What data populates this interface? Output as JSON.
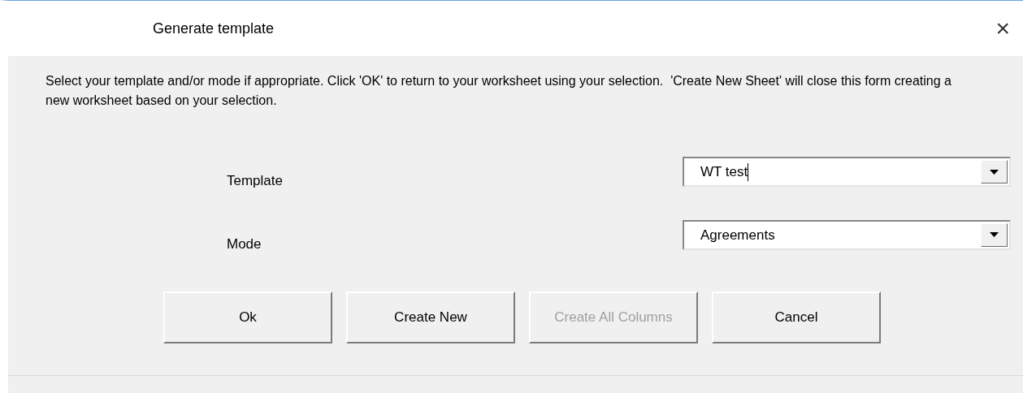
{
  "window": {
    "title": "Generate template",
    "close": "×"
  },
  "instructions": "Select your template and/or mode if appropriate. Click 'OK' to return to your worksheet using your selection.  'Create New Sheet' will close this form creating a new worksheet based on your selection.",
  "fields": [
    {
      "label": "Template",
      "value": "WT test",
      "focused": true
    },
    {
      "label": "Mode",
      "value": "Agreements",
      "focused": false
    }
  ],
  "buttons": [
    {
      "label": "Ok",
      "disabled": false
    },
    {
      "label": "Create New",
      "disabled": false
    },
    {
      "label": "Create All Columns",
      "disabled": true
    },
    {
      "label": "Cancel",
      "disabled": false
    }
  ]
}
